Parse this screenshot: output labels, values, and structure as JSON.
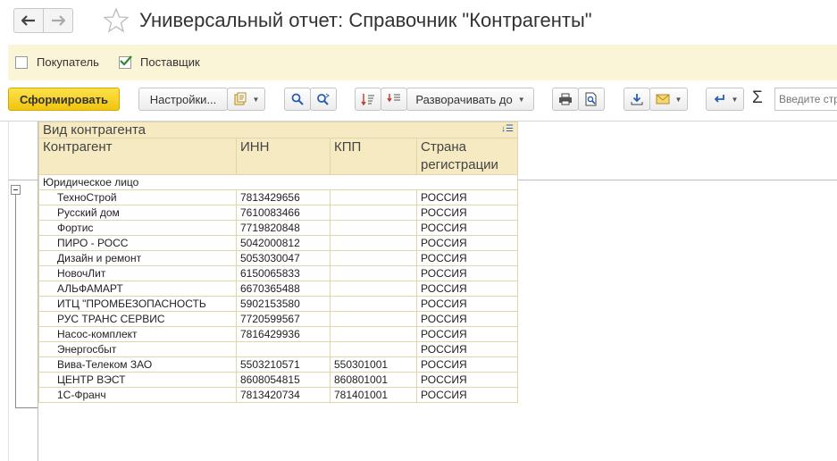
{
  "window": {
    "title": "Универсальный отчет: Справочник \"Контрагенты\""
  },
  "filters": [
    {
      "label": "Покупатель",
      "checked": false
    },
    {
      "label": "Поставщик",
      "checked": true
    }
  ],
  "toolbar": {
    "generate_label": "Сформировать",
    "settings_label": "Настройки...",
    "expand_label": "Разворачивать до",
    "search_placeholder": "Введите стр"
  },
  "report": {
    "header_group": "Вид контрагента",
    "columns": [
      "Контрагент",
      "ИНН",
      "КПП",
      "Страна регистрации"
    ],
    "group_name": "Юридическое лицо",
    "rows": [
      {
        "name": "ТехноСтрой",
        "inn": "7813429656",
        "kpp": "",
        "country": "РОССИЯ"
      },
      {
        "name": "Русский дом",
        "inn": "7610083466",
        "kpp": "",
        "country": "РОССИЯ"
      },
      {
        "name": "Фортис",
        "inn": "7719820848",
        "kpp": "",
        "country": "РОССИЯ"
      },
      {
        "name": "ПИРО - РОСС",
        "inn": "5042000812",
        "kpp": "",
        "country": "РОССИЯ"
      },
      {
        "name": "Дизайн и ремонт",
        "inn": "5053030047",
        "kpp": "",
        "country": "РОССИЯ"
      },
      {
        "name": "НовочЛит",
        "inn": "6150065833",
        "kpp": "",
        "country": "РОССИЯ"
      },
      {
        "name": "АЛЬФАМАРТ",
        "inn": "6670365488",
        "kpp": "",
        "country": "РОССИЯ"
      },
      {
        "name": "ИТЦ \"ПРОМБЕЗОПАСНОСТЬ",
        "inn": "5902153580",
        "kpp": "",
        "country": "РОССИЯ"
      },
      {
        "name": "РУС ТРАНС СЕРВИС",
        "inn": "7720599567",
        "kpp": "",
        "country": "РОССИЯ"
      },
      {
        "name": "Насос-комплект",
        "inn": "7816429936",
        "kpp": "",
        "country": "РОССИЯ"
      },
      {
        "name": "Энергосбыт",
        "inn": "",
        "kpp": "",
        "country": "РОССИЯ"
      },
      {
        "name": "Вива-Телеком ЗАО",
        "inn": "5503210571",
        "kpp": "550301001",
        "country": "РОССИЯ"
      },
      {
        "name": "ЦЕНТР ВЭСТ",
        "inn": "8608054815",
        "kpp": "860801001",
        "country": "РОССИЯ"
      },
      {
        "name": "1С-Франч",
        "inn": "7813420734",
        "kpp": "781401001",
        "country": "РОССИЯ"
      }
    ]
  },
  "colors": {
    "accent": "#f1c40f",
    "filter_bg": "#fbf5d8",
    "header_bg": "#f5eac2",
    "checkmark": "#2e8b2e"
  }
}
